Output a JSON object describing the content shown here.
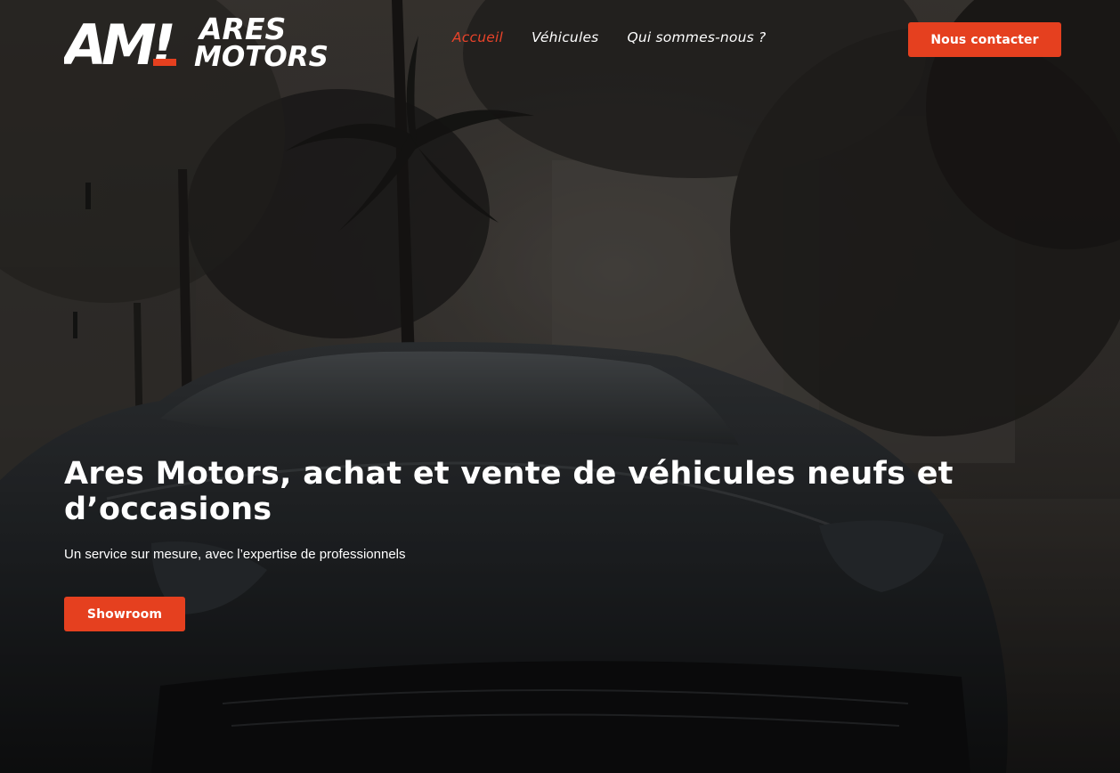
{
  "brand": {
    "logo_mark": "AM!",
    "logo_line1": "ARES",
    "logo_line2": "MOTORS",
    "accent_color": "#e5401f"
  },
  "nav": {
    "items": [
      {
        "label": "Accueil",
        "active": true
      },
      {
        "label": "Véhicules",
        "active": false
      },
      {
        "label": "Qui sommes-nous ?",
        "active": false
      }
    ]
  },
  "header": {
    "cta_label": "Nous contacter"
  },
  "hero": {
    "title": "Ares Motors, achat et vente de véhicules neufs et d’occasions",
    "subtitle": "Un service sur mesure, avec l’expertise de professionnels",
    "cta_label": "Showroom",
    "background_image": "dark-supercar-palm-trees-photo"
  }
}
